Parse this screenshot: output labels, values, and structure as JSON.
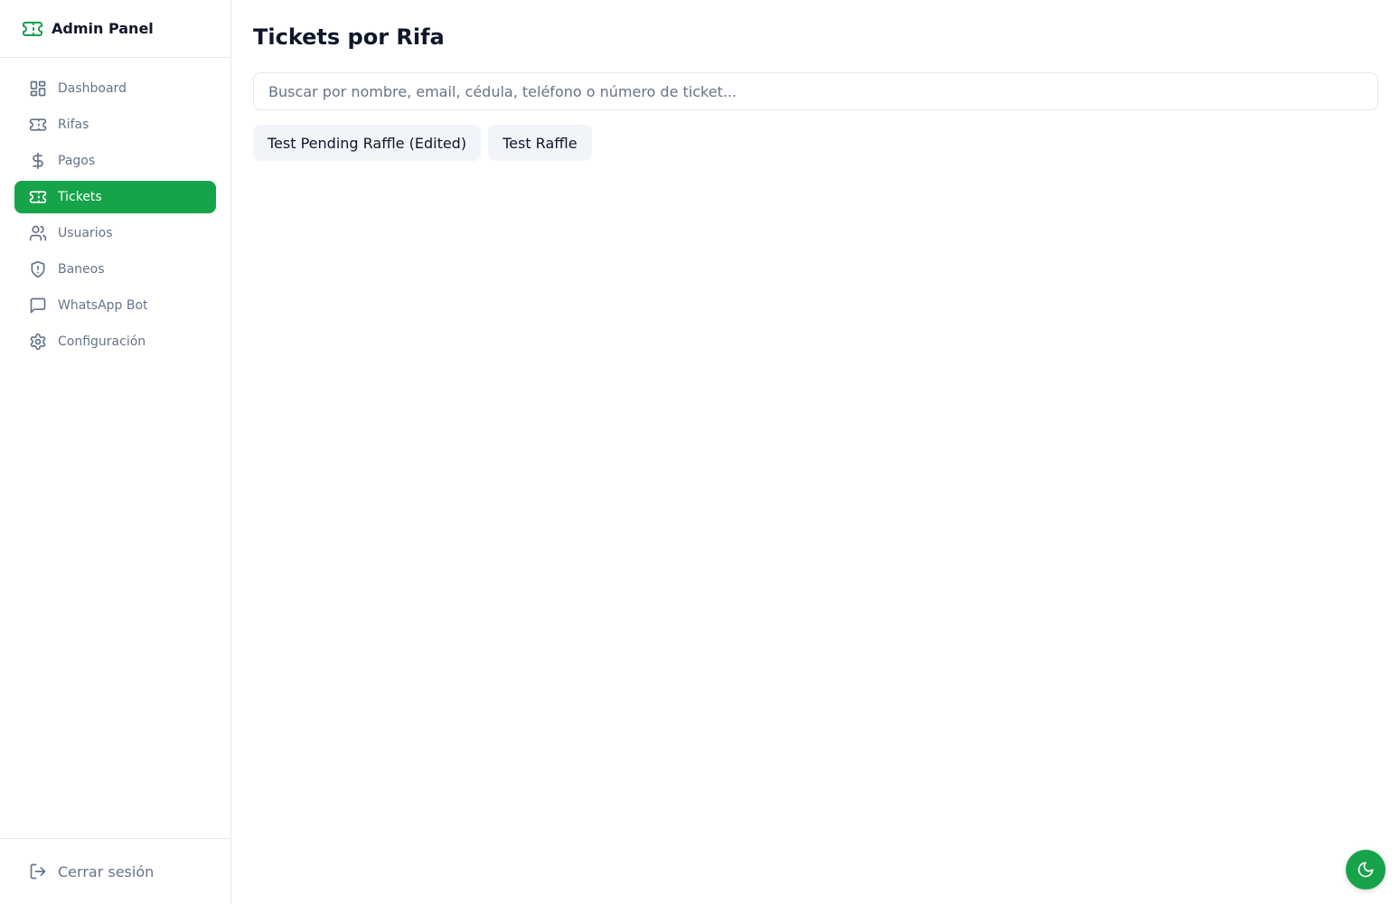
{
  "app": {
    "title": "Admin Panel"
  },
  "sidebar": {
    "items": [
      {
        "label": "Dashboard",
        "icon": "dashboard-icon"
      },
      {
        "label": "Rifas",
        "icon": "ticket-icon"
      },
      {
        "label": "Pagos",
        "icon": "dollar-icon"
      },
      {
        "label": "Tickets",
        "icon": "ticket-icon",
        "active": true
      },
      {
        "label": "Usuarios",
        "icon": "users-icon"
      },
      {
        "label": "Baneos",
        "icon": "shield-icon"
      },
      {
        "label": "WhatsApp Bot",
        "icon": "message-icon"
      },
      {
        "label": "Configuración",
        "icon": "gear-icon"
      }
    ],
    "logout_label": "Cerrar sesión"
  },
  "main": {
    "title": "Tickets por Rifa",
    "search": {
      "placeholder": "Buscar por nombre, email, cédula, teléfono o número de ticket...",
      "value": ""
    },
    "raffles": [
      "Test Pending Raffle (Edited)",
      "Test Raffle"
    ]
  },
  "colors": {
    "accent": "#16a34a",
    "chip_bg": "#f1f5f9",
    "muted_text": "#64748b"
  },
  "theme_toggle": {
    "icon": "moon-icon"
  }
}
